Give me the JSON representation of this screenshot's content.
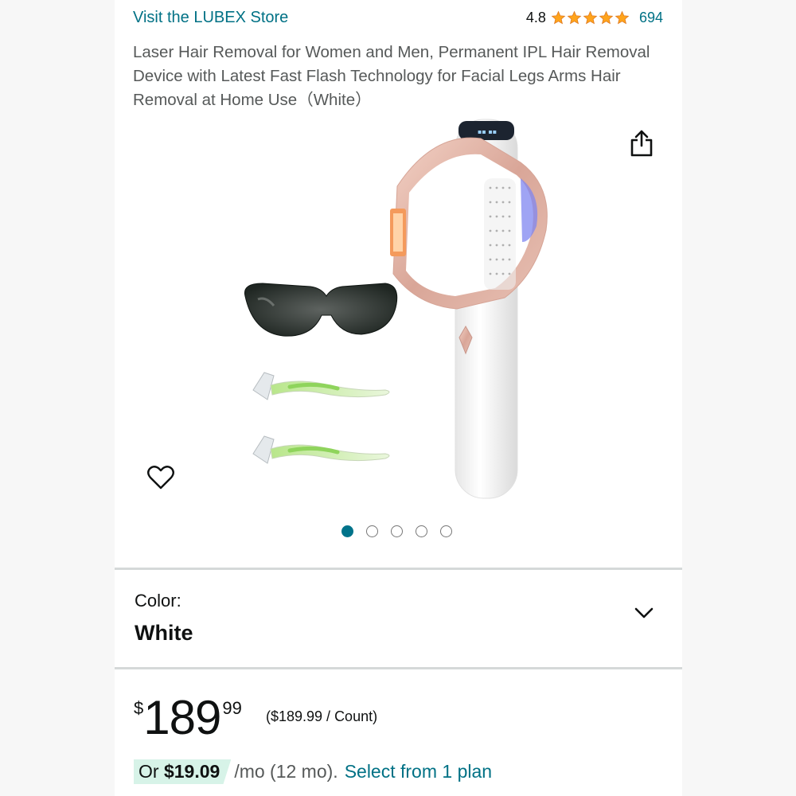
{
  "store": {
    "link_text": "Visit the LUBEX Store"
  },
  "rating": {
    "value": "4.8",
    "stars": 5,
    "count": "694"
  },
  "product": {
    "title": "Laser Hair Removal for Women and Men, Permanent IPL Hair Removal Device with Latest Fast Flash Technology for Facial Legs Arms Hair Removal at Home Use（White）"
  },
  "gallery": {
    "image_count": 5,
    "active_index": 0,
    "icons": {
      "share": "share-icon",
      "favorite": "heart-icon"
    }
  },
  "color": {
    "label": "Color:",
    "value": "White",
    "expand_icon": "chevron-down-icon"
  },
  "price": {
    "symbol": "$",
    "whole": "189",
    "fraction": "99",
    "unit_price": "($189.99 / Count)"
  },
  "installment": {
    "prefix": "Or ",
    "amount": "$19.09",
    "term": " /mo (12 mo).",
    "link": "Select from 1 plan"
  },
  "colors": {
    "link": "#007185",
    "star": "#ffa41c",
    "active_dot": "#00738a",
    "highlight": "#d7f3e8"
  }
}
